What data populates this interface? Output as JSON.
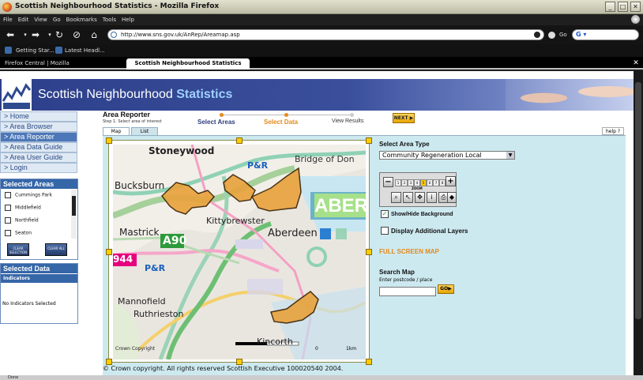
{
  "browser": {
    "window_title": "Scottish Neighbourhood Statistics - Mozilla Firefox",
    "menu": [
      "File",
      "Edit",
      "View",
      "Go",
      "Bookmarks",
      "Tools",
      "Help"
    ],
    "url": "http://www.sns.gov.uk/AnRep/Areamap.asp",
    "go_label": "Go",
    "search_engine": "G",
    "bookmarks": [
      "Getting Star...",
      "Latest Headl..."
    ],
    "tabs": [
      "Firefox Central | Mozilla",
      "Scottish Neighbourhood Statistics"
    ],
    "status": "Done"
  },
  "site": {
    "title_plain": "Scottish Neighbourhood ",
    "title_bold": "Statistics"
  },
  "nav": [
    "> Home",
    "> Area Browser",
    "> Area Reporter",
    "> Area Data Guide",
    "> Area User Guide",
    "> Login"
  ],
  "selected_areas": {
    "heading": "Selected Areas",
    "items": [
      "Cummings Park",
      "Middlefield",
      "Northfield",
      "Seaton"
    ],
    "clear_selection": "CLEAR SELECTION",
    "clear_all": "CLEAR ALL"
  },
  "selected_data": {
    "heading": "Selected Data",
    "indicators_label": "Indicators",
    "empty_text": "No Indicators Selected"
  },
  "reporter": {
    "title": "Area Reporter",
    "step_text": "Step 1. Select area of interest",
    "steps": [
      "Select Areas",
      "Select Data",
      "View Results"
    ],
    "next_label": "NEXT",
    "tab_map": "Map",
    "tab_list": "List",
    "help_label": "help ?"
  },
  "map": {
    "labels": {
      "stoneywood": "Stoneywood",
      "pr1": "P&R",
      "bridge": "Bridge of Don",
      "bucksburn": "Bucksburn",
      "kittybrewster": "Kittybrewster",
      "aber": "ABER",
      "mastrick": "Mastrick",
      "a90": "A90",
      "aberdeen": "Aberdeen",
      "r944": "944",
      "pr2": "P&R",
      "mannofield": "Mannofield",
      "ruthrieston": "Ruthrieston",
      "kincorth": "Kincorth",
      "crown": "Crown Copyright",
      "scale_start": "0",
      "scale_end": "1km"
    },
    "copyright_notice": "© Crown copyright. All rights reserved Scottish Executive 100020540 2004."
  },
  "controls": {
    "area_type_label": "Select Area Type",
    "area_type_value": "Community Regeneration Local",
    "zoom_label": "ZOOM",
    "zoom_levels": [
      "1",
      "2",
      "3",
      "4",
      "5",
      "6",
      "7",
      "8",
      "9"
    ],
    "zoom_current": 5,
    "show_background_label": "Show/Hide Background",
    "show_background_checked": true,
    "additional_layers_label": "Display Additional Layers",
    "additional_layers_checked": false,
    "full_screen_label": "FULL SCREEN MAP",
    "search_map_label": "Search Map",
    "search_hint": "Enter postcode / place",
    "search_value": "",
    "go_label": "GO"
  }
}
